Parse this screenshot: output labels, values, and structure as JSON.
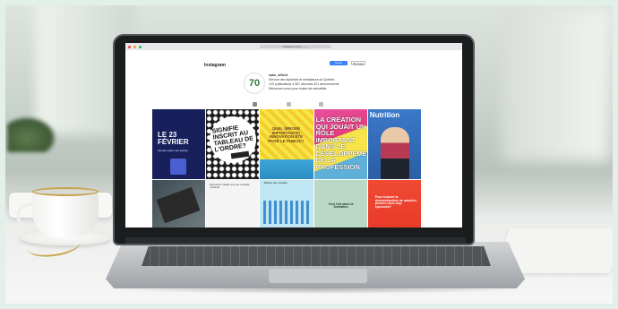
{
  "browser": {
    "url": "instagram.com/_____"
  },
  "instagram": {
    "brand": "Instagram",
    "avatar_text": "70",
    "profile_name": "sabo_officiel",
    "profile_lines": [
      "Service des diplômés et médiateurs de Québec",
      "123 publications  4 567 abonnés  321 abonnements",
      "Retrouvez-nous pour toutes les actualités"
    ],
    "follow_label": "Suivre",
    "message_label": "Message"
  },
  "posts": {
    "p1_big": "LE 23 FÉVRIER",
    "p1_small": "l'école ouvre ses portes",
    "p2": "SIGNIFIE INSCRIT AU TABLEAU DE L'ORDRE?",
    "p3": "QUEL (BRODÉ IMPORTANTE) INNOVATION ÉTÉ POSÉ LE PUBLIC?",
    "p4": "LA CRÉATION QUI JOUAIT UN RÔLE IMPORTANT DANS LE DÉVELOPPEMENT DE LA PROFESSION",
    "p5": "Nutrition",
    "p7": "Découvrez l'atelier sur une nouvelle méthode",
    "p8": "Tableau des résultats",
    "p9": "Vers l'art dans la formation",
    "p10": "Pour trouver la déconstruction de manière, pensez-vous trop éprouvés?"
  },
  "colors": {
    "follow": "#3b82f6",
    "brand_green": "#2f7a3c"
  }
}
